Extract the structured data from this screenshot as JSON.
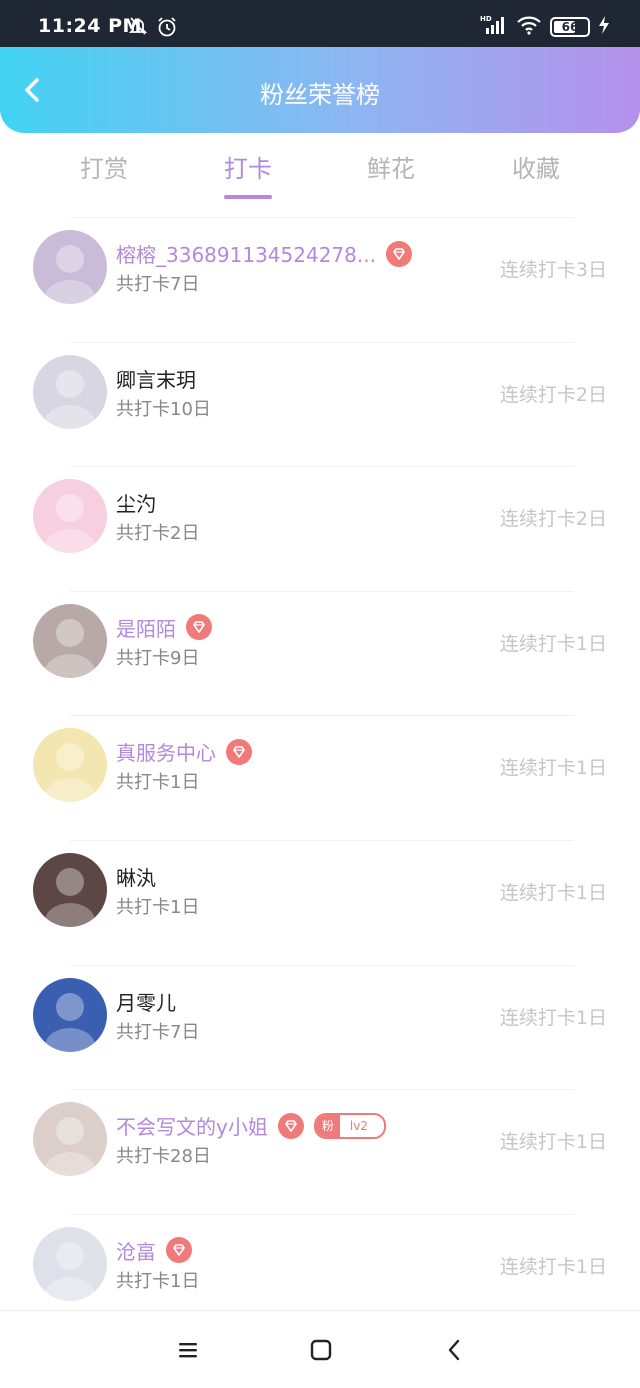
{
  "status_bar": {
    "time": "11:24 PM",
    "icons_left": [
      "bell-muted-icon",
      "alarm-icon"
    ],
    "icons_right": [
      "hd-signal-icon",
      "wifi-icon",
      "battery-icon",
      "charging-icon"
    ],
    "battery_level": "66"
  },
  "header": {
    "title": "粉丝荣誉榜",
    "back_icon": "chevron-left-icon"
  },
  "tabs": {
    "items": [
      "打赏",
      "打卡",
      "鲜花",
      "收藏"
    ],
    "active_index": 1
  },
  "fans": [
    {
      "name": "榕榕_336891134524278...",
      "total": "共打卡7日",
      "streak": "连续打卡3日",
      "vip": true,
      "avatar_color": "#c9bcd8"
    },
    {
      "name": "卿言末玥",
      "total": "共打卡10日",
      "streak": "连续打卡2日",
      "vip": false,
      "avatar_color": "#d9d6e3"
    },
    {
      "name": "尘汋",
      "total": "共打卡2日",
      "streak": "连续打卡2日",
      "vip": false,
      "avatar_color": "#f6cfe0"
    },
    {
      "name": "是陌陌",
      "total": "共打卡9日",
      "streak": "连续打卡1日",
      "vip": true,
      "avatar_color": "#b9a9a6"
    },
    {
      "name": "真服务中心",
      "total": "共打卡1日",
      "streak": "连续打卡1日",
      "vip": true,
      "avatar_color": "#f4e6b0"
    },
    {
      "name": "晽汍",
      "total": "共打卡1日",
      "streak": "连续打卡1日",
      "vip": false,
      "avatar_color": "#5c4744"
    },
    {
      "name": "月零儿",
      "total": "共打卡7日",
      "streak": "连续打卡1日",
      "vip": false,
      "avatar_color": "#3b5fb0"
    },
    {
      "name": "不会写文的y小姐",
      "total": "共打卡28日",
      "streak": "连续打卡1日",
      "vip": true,
      "fan_badge": {
        "label": "粉",
        "level": "lv2"
      },
      "avatar_color": "#dccfc9"
    },
    {
      "name": "沧畗",
      "total": "共打卡1日",
      "streak": "连续打卡1日",
      "vip": true,
      "avatar_color": "#dfe1ea"
    }
  ],
  "colors": {
    "accent": "#b388de",
    "badge": "#f07a7a",
    "header_gradient_start": "#42d3f2",
    "header_gradient_end": "#b591ec"
  },
  "nav_bar": {
    "icons": [
      "menu-icon",
      "home-square-icon",
      "back-triangle-icon"
    ]
  }
}
